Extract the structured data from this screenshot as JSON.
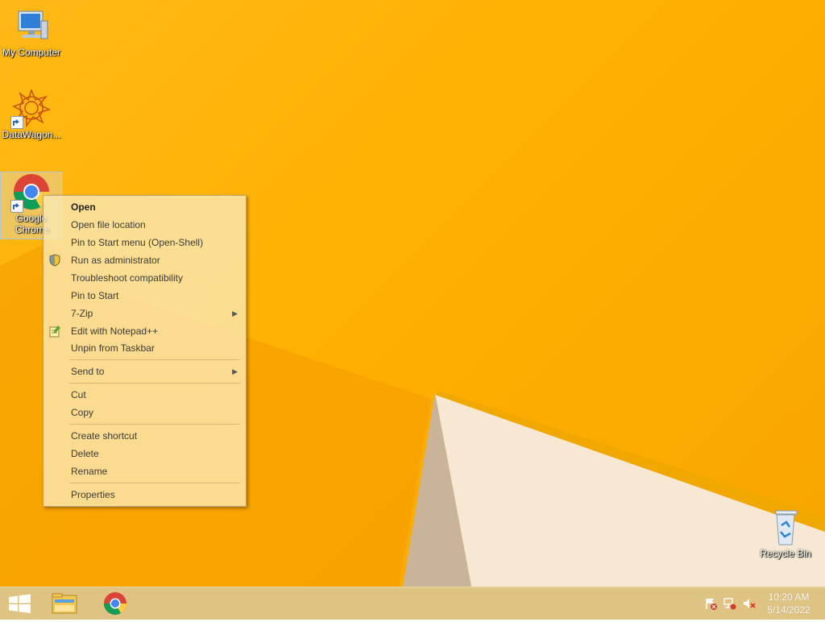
{
  "desktop": {
    "icons": [
      {
        "label": "My Computer",
        "icon": "computer-icon"
      },
      {
        "label": "DataWagon...",
        "icon": "datawagon-icon"
      },
      {
        "label": "Google Chrome",
        "icon": "chrome-icon"
      },
      {
        "label": "Recycle Bin",
        "icon": "recycle-bin-icon"
      }
    ]
  },
  "context_menu": {
    "items": [
      {
        "label": "Open"
      },
      {
        "label": "Open file location"
      },
      {
        "label": "Pin to Start menu (Open-Shell)"
      },
      {
        "label": "Run as administrator",
        "icon": "shield-icon"
      },
      {
        "label": "Troubleshoot compatibility"
      },
      {
        "label": "Pin to Start"
      },
      {
        "label": "7-Zip",
        "submenu": true
      },
      {
        "label": "Edit with Notepad++",
        "icon": "notepad-plus-icon"
      },
      {
        "label": "Unpin from Taskbar"
      },
      {
        "label": "Send to",
        "submenu": true
      },
      {
        "label": "Cut"
      },
      {
        "label": "Copy"
      },
      {
        "label": "Create shortcut"
      },
      {
        "label": "Delete"
      },
      {
        "label": "Rename"
      },
      {
        "label": "Properties"
      }
    ],
    "submenu_arrow": "▶"
  },
  "taskbar": {
    "start_icon": "windows-logo-icon",
    "pinned": [
      "file-explorer-icon",
      "chrome-icon"
    ],
    "tray": [
      "action-center-flag-icon",
      "network-icon",
      "volume-muted-icon"
    ],
    "clock": {
      "time": "10:20 AM",
      "date": "5/14/2022"
    }
  },
  "colors": {
    "wallpaper": "#ffb000",
    "menu_background": "#fae9b4",
    "taskbar": "#dcbe78"
  }
}
